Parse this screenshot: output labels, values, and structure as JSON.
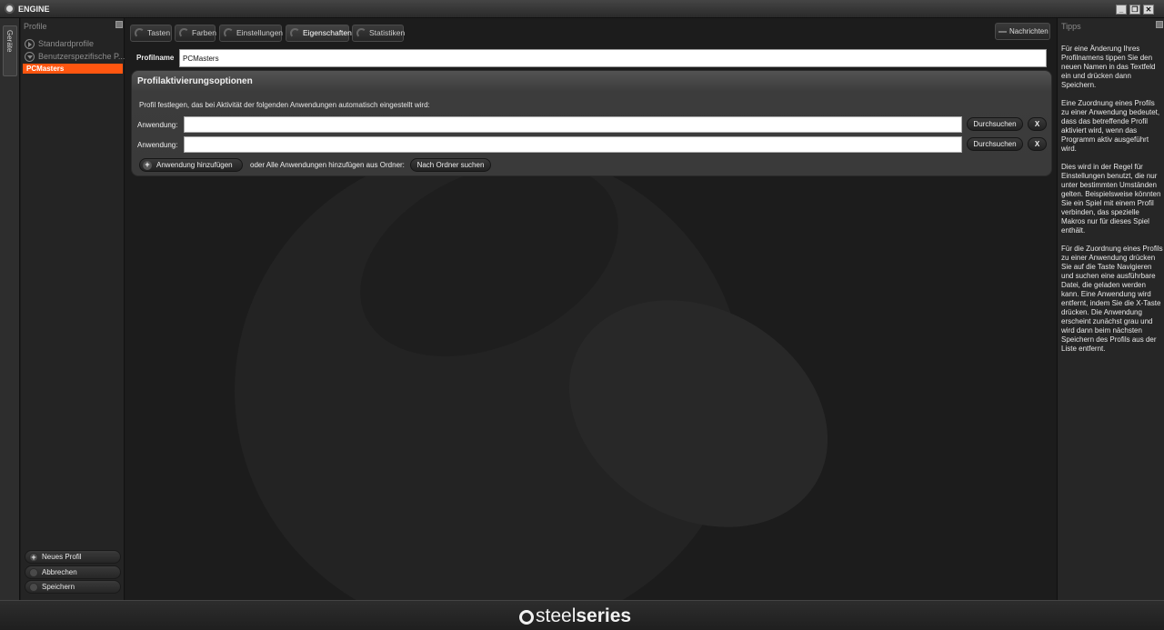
{
  "window": {
    "title": "ENGINE",
    "minimize_glyph": "_",
    "restore_glyph": "❐",
    "close_glyph": "✕"
  },
  "devices_tab": {
    "label": "Geräte"
  },
  "profiles_panel": {
    "heading": "Profile",
    "tree": [
      {
        "label": "Standardprofile",
        "icon": "chevron-right-icon"
      },
      {
        "label": "Benutzerspezifische P...",
        "icon": "chevron-down-icon"
      }
    ],
    "selected_profile": "PCMasters",
    "actions": {
      "new_profile": "Neues Profil",
      "new_profile_glyph": "+",
      "cancel": "Abbrechen",
      "save": "Speichern"
    }
  },
  "tabs": [
    {
      "label": "Tasten",
      "active": false
    },
    {
      "label": "Farben",
      "active": false
    },
    {
      "label": "Einstellungen",
      "active": false
    },
    {
      "label": "Eigenschaften",
      "active": true
    },
    {
      "label": "Statistiken",
      "active": false
    }
  ],
  "messages_button": "Nachrichten",
  "profile_name": {
    "label": "Profilname",
    "value": "PCMasters"
  },
  "activation_options": {
    "title": "Profilaktivierungsoptionen",
    "description": "Profil festlegen, das bei Aktivität der folgenden Anwendungen automatisch eingestellt wird:",
    "rows": [
      {
        "label": "Anwendung:",
        "value": "",
        "browse": "Durchsuchen",
        "remove": "X"
      },
      {
        "label": "Anwendung:",
        "value": "",
        "browse": "Durchsuchen",
        "remove": "X"
      }
    ],
    "add_app_button": "Anwendung hinzufügen",
    "add_app_glyph": "+",
    "or_text": "oder Alle Anwendungen hinzufügen aus Ordner:",
    "folder_button": "Nach Ordner suchen"
  },
  "tips_panel": {
    "heading": "Tipps",
    "text": "Für eine Änderung Ihres Profilnamens tippen Sie den neuen Namen in das Textfeld ein und drücken dann Speichern.\n\nEine Zuordnung eines Profils zu einer Anwendung bedeutet, dass das betreffende Profil aktiviert wird, wenn das Programm aktiv ausgeführt wird.\n\nDies wird in der Regel für Einstellungen benutzt, die nur unter bestimmten Umständen gelten.  Beispielsweise könnten Sie ein Spiel mit einem Profil verbinden, das spezielle Makros nur für dieses Spiel enthält.\n\nFür die Zuordnung eines Profils zu einer Anwendung drücken Sie auf die Taste Navigieren und suchen eine ausführbare Datei, die geladen werden kann.  Eine Anwendung wird entfernt, indem Sie die X-Taste drücken. Die Anwendung erscheint zunächst grau und wird dann beim nächsten Speichern des Profils aus der Liste entfernt."
  },
  "footer": {
    "brand_light": "steel",
    "brand_bold": "series"
  },
  "colors": {
    "accent": "#ff5610",
    "background": "#1c1c1c",
    "panel": "#242424"
  }
}
